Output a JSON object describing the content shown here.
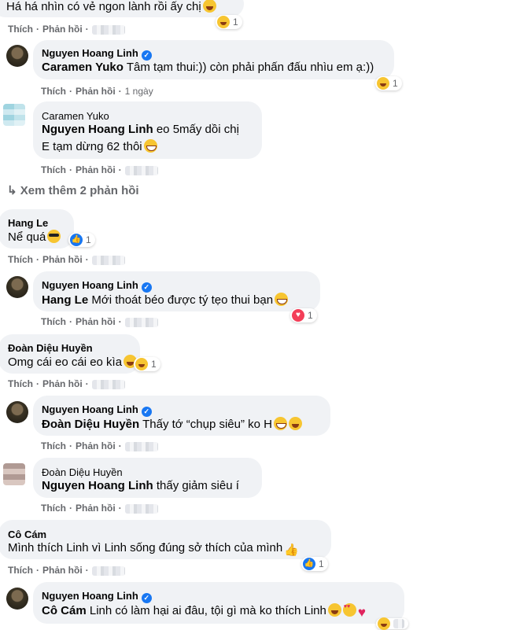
{
  "labels": {
    "like": "Thích",
    "reply": "Phản hồi"
  },
  "c0": {
    "text": "Há há nhìn có vẻ ngon lành rồi ấy chị",
    "react_count": "1"
  },
  "c1": {
    "author": "Nguyen Hoang Linh",
    "mention": "Caramen Yuko",
    "text": "Tâm tạm thui:)) còn phải phấn đấu nhìu em ạ:))",
    "time": "1 ngày",
    "react_count": "1"
  },
  "c2": {
    "author": "Caramen Yuko",
    "mention": "Nguyen Hoang Linh",
    "text": "eo 5mấy dồi chị",
    "text2": "E tạm dừng 62 thôi"
  },
  "more_replies": "↳ Xem thêm 2 phản hồi",
  "c3": {
    "author": "Hang Le",
    "text": "Nể quá",
    "react_count": "1"
  },
  "c4": {
    "author": "Nguyen Hoang Linh",
    "mention": "Hang Le",
    "text": "Mới thoát béo được tý tẹo thui bạn",
    "react_count": "1"
  },
  "c5": {
    "author": "Đoàn Diệu Huyền",
    "text": "Omg cái eo cái eo kìa",
    "react_count": "1"
  },
  "c6": {
    "author": "Nguyen Hoang Linh",
    "mention": "Đoàn Diệu Huyền",
    "text": "Thấy tớ “chụp siêu” ko H"
  },
  "c7": {
    "author": "Đoàn Diệu Huyền",
    "mention": "Nguyen Hoang Linh",
    "text": "thấy giảm siêu í"
  },
  "c8": {
    "author": "Cô Cám",
    "text": "Mình thích Linh vì Linh sống đúng sở thích của mình",
    "react_count": "1"
  },
  "c9": {
    "author": "Nguyen Hoang Linh",
    "mention": "Cô Cám",
    "text": "Linh có làm hại ai đâu, tội gì mà ko thích Linh"
  }
}
